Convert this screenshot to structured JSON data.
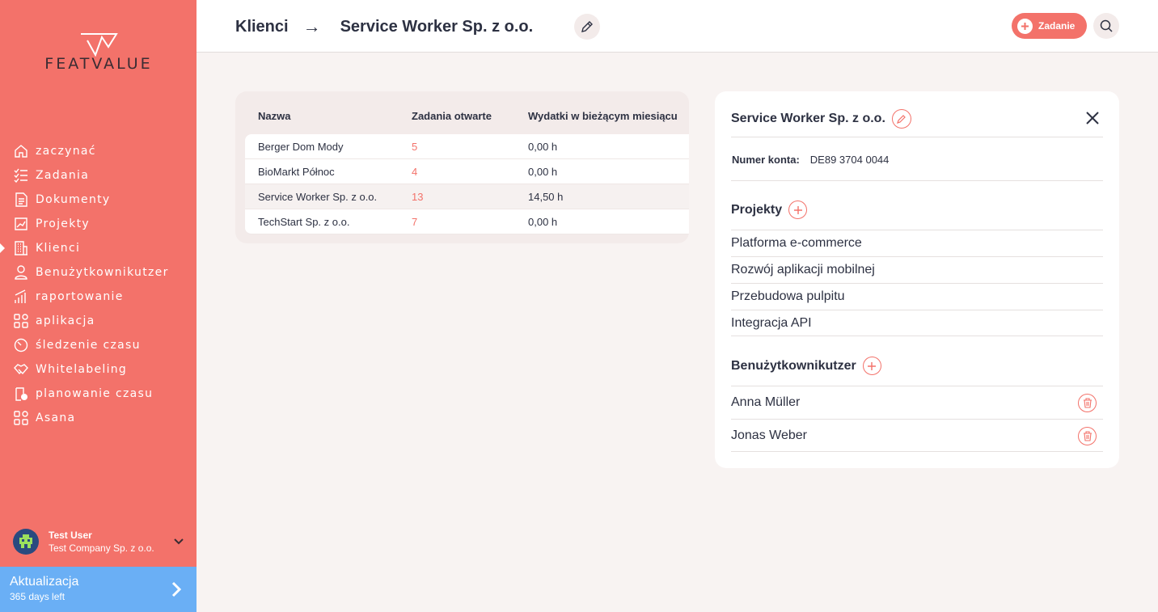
{
  "brand": {
    "logo_text": "FEATVALUE",
    "accent": "#f3726a",
    "upgrade_color": "#6aaff5"
  },
  "sidebar": {
    "items": [
      {
        "label": "zaczynać",
        "icon": "home-icon"
      },
      {
        "label": "Zadania",
        "icon": "checklist-icon"
      },
      {
        "label": "Dokumenty",
        "icon": "documents-icon"
      },
      {
        "label": "Projekty",
        "icon": "chart-icon"
      },
      {
        "label": "Klienci",
        "icon": "building-icon",
        "active": true
      },
      {
        "label": "Benużytkownikutzer",
        "icon": "user-icon"
      },
      {
        "label": "raportowanie",
        "icon": "bars-icon"
      },
      {
        "label": "aplikacja",
        "icon": "apps-icon"
      },
      {
        "label": "śledzenie czasu",
        "icon": "timer-icon"
      },
      {
        "label": "Whitelabeling",
        "icon": "handshake-icon"
      },
      {
        "label": "planowanie czasu",
        "icon": "clipboard-clock-icon"
      },
      {
        "label": "Asana",
        "icon": "apps-icon"
      }
    ],
    "user": {
      "name": "Test User",
      "company": "Test Company Sp. z o.o."
    },
    "upgrade": {
      "title": "Aktualizacja",
      "subtitle": "365 days left"
    }
  },
  "header": {
    "crumb_parent": "Klienci",
    "crumb_arrow": "→",
    "crumb_current": "Service Worker Sp. z o.o.",
    "task_button": "Zadanie"
  },
  "table": {
    "headers": [
      "Nazwa",
      "Zadania otwarte",
      "Wydatki w bieżącym miesiącu"
    ],
    "rows": [
      {
        "name": "Berger Dom Mody",
        "open": "5",
        "spend": "0,00 h"
      },
      {
        "name": "BioMarkt Północ",
        "open": "4",
        "spend": "0,00 h"
      },
      {
        "name": "Service Worker Sp. z o.o.",
        "open": "13",
        "spend": "14,50 h",
        "selected": true
      },
      {
        "name": "TechStart Sp. z o.o.",
        "open": "7",
        "spend": "0,00 h"
      }
    ]
  },
  "panel": {
    "title": "Service Worker Sp. z o.o.",
    "account_label": "Numer konta:",
    "account_value": "DE89 3704 0044",
    "projects_heading": "Projekty",
    "projects": [
      "Platforma e-commerce",
      "Rozwój aplikacji mobilnej",
      "Przebudowa pulpitu",
      "Integracja API"
    ],
    "users_heading": "Benużytkownikutzer",
    "users": [
      "Anna Müller",
      "Jonas Weber"
    ]
  }
}
